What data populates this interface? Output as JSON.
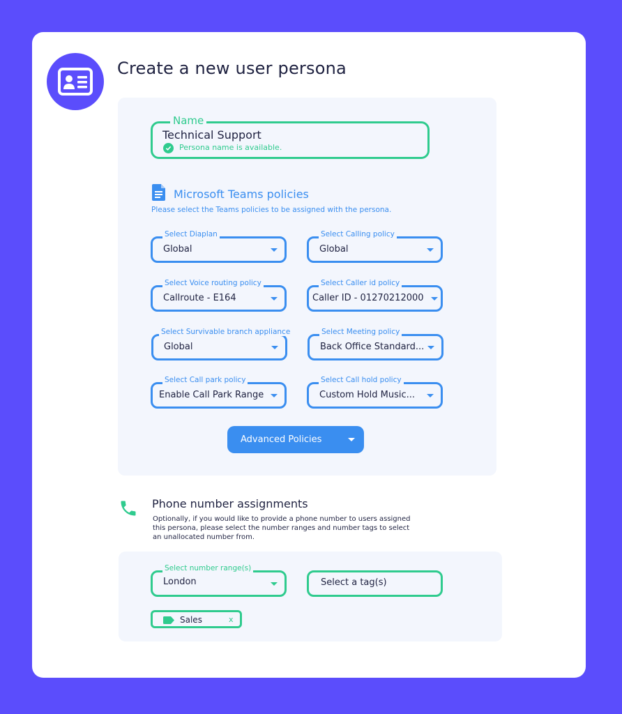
{
  "header": {
    "title": "Create a new user persona",
    "icon": "id-card-icon"
  },
  "name_field": {
    "legend": "Name",
    "value": "Technical Support",
    "status": "Persona name is available."
  },
  "teams": {
    "title": "Microsoft Teams policies",
    "subtitle": "Please select the Teams policies to be assigned with the persona.",
    "selects": [
      {
        "label": "Select Diaplan",
        "value": "Global"
      },
      {
        "label": "Select Calling policy",
        "value": "Global"
      },
      {
        "label": "Select Voice routing policy",
        "value": "Callroute - E164"
      },
      {
        "label": "Select Caller id policy",
        "value": "Caller ID - 01270212000"
      },
      {
        "label": "Select Survivable branch appliance",
        "value": "Global"
      },
      {
        "label": "Select Meeting policy",
        "value": "Back Office Standard..."
      },
      {
        "label": "Select Call park policy",
        "value": "Enable Call Park Range"
      },
      {
        "label": "Select Call hold policy",
        "value": "Custom Hold Music..."
      }
    ],
    "advanced_button": "Advanced Policies"
  },
  "phone": {
    "title": "Phone number assignments",
    "description": "Optionally, if you would like to provide a phone number to users assigned this persona, please select the number ranges and number tags to select an unallocated number from.",
    "range_select": {
      "label": "Select number range(s)",
      "value": "London"
    },
    "tag_select": {
      "value": "Select a tag(s)"
    },
    "tags": [
      {
        "label": "Sales",
        "close": "x"
      }
    ]
  },
  "colors": {
    "background": "#5b4dfc",
    "accent_blue": "#3a8ef0",
    "accent_green": "#2fcb8e",
    "panel": "#f3f6fd",
    "text": "#1e2140"
  }
}
